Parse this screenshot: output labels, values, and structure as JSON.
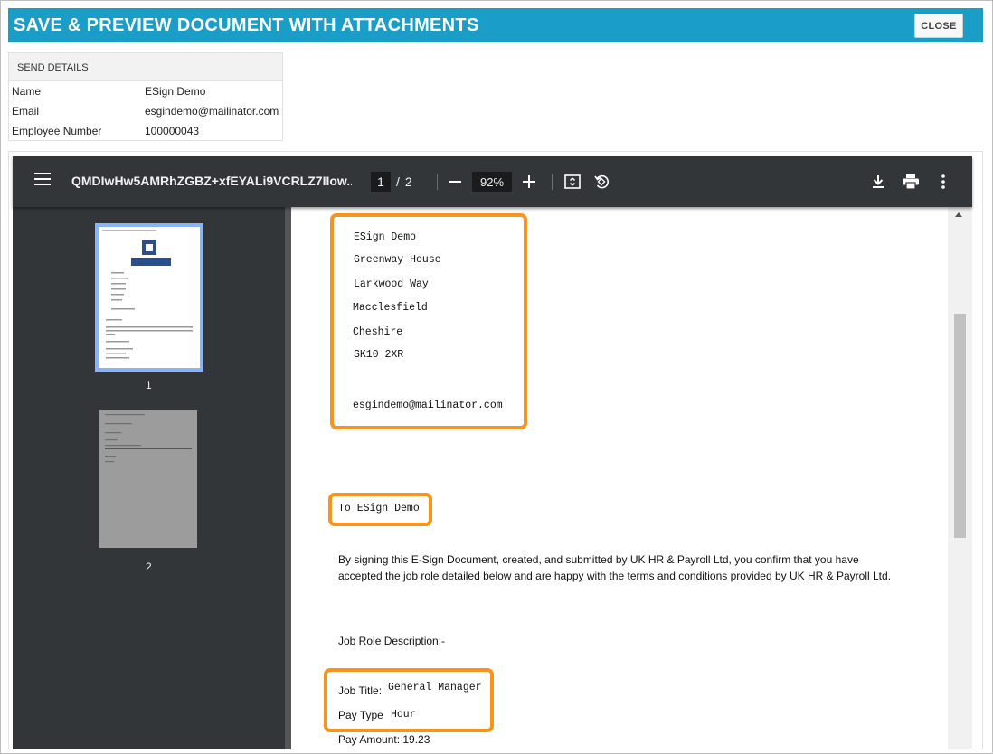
{
  "window": {
    "title": "SAVE & PREVIEW DOCUMENT WITH ATTACHMENTS",
    "close_label": "CLOSE"
  },
  "send_details": {
    "header": "SEND DETAILS",
    "rows": [
      {
        "label": "Name",
        "value": "ESign Demo"
      },
      {
        "label": "Email",
        "value": "esgindemo@mailinator.com"
      },
      {
        "label": "Employee Number",
        "value": "100000043"
      }
    ]
  },
  "viewer": {
    "filename": "QMDIwHw5AMRhZGBZ+xfEYALi9VCRLZ7IIow...",
    "current_page": "1",
    "page_separator": "/",
    "total_pages": "2",
    "zoom": "92%",
    "thumbnails": [
      {
        "label": "1"
      },
      {
        "label": "2"
      }
    ]
  },
  "document": {
    "address_lines": [
      "ESign Demo",
      "Greenway House",
      "Larkwood Way",
      "Macclesfield",
      "Cheshire",
      "SK10 2XR"
    ],
    "email": "esgindemo@mailinator.com",
    "to_line": "To ESign Demo",
    "paragraph": "By signing this E-Sign Document, created, and submitted by UK HR & Payroll Ltd, you confirm that you have accepted the job role detailed below and are happy with the terms and conditions provided by UK HR & Payroll Ltd.",
    "job_role_heading": "Job Role Description:-",
    "job_title_label": "Job Title:",
    "job_title_value": "General Manager",
    "pay_type_label": "Pay Type",
    "pay_type_value": "Hour",
    "pay_amount": "Pay Amount: 19.23"
  },
  "colors": {
    "title_bar": "#1a9ec8",
    "highlight": "#f7941d",
    "toolbar": "#323639",
    "doc_bg": "#525659"
  },
  "icons": [
    "menu-icon",
    "minus-icon",
    "plus-icon",
    "fit-page-icon",
    "rotate-icon",
    "download-icon",
    "print-icon",
    "more-vert-icon"
  ]
}
